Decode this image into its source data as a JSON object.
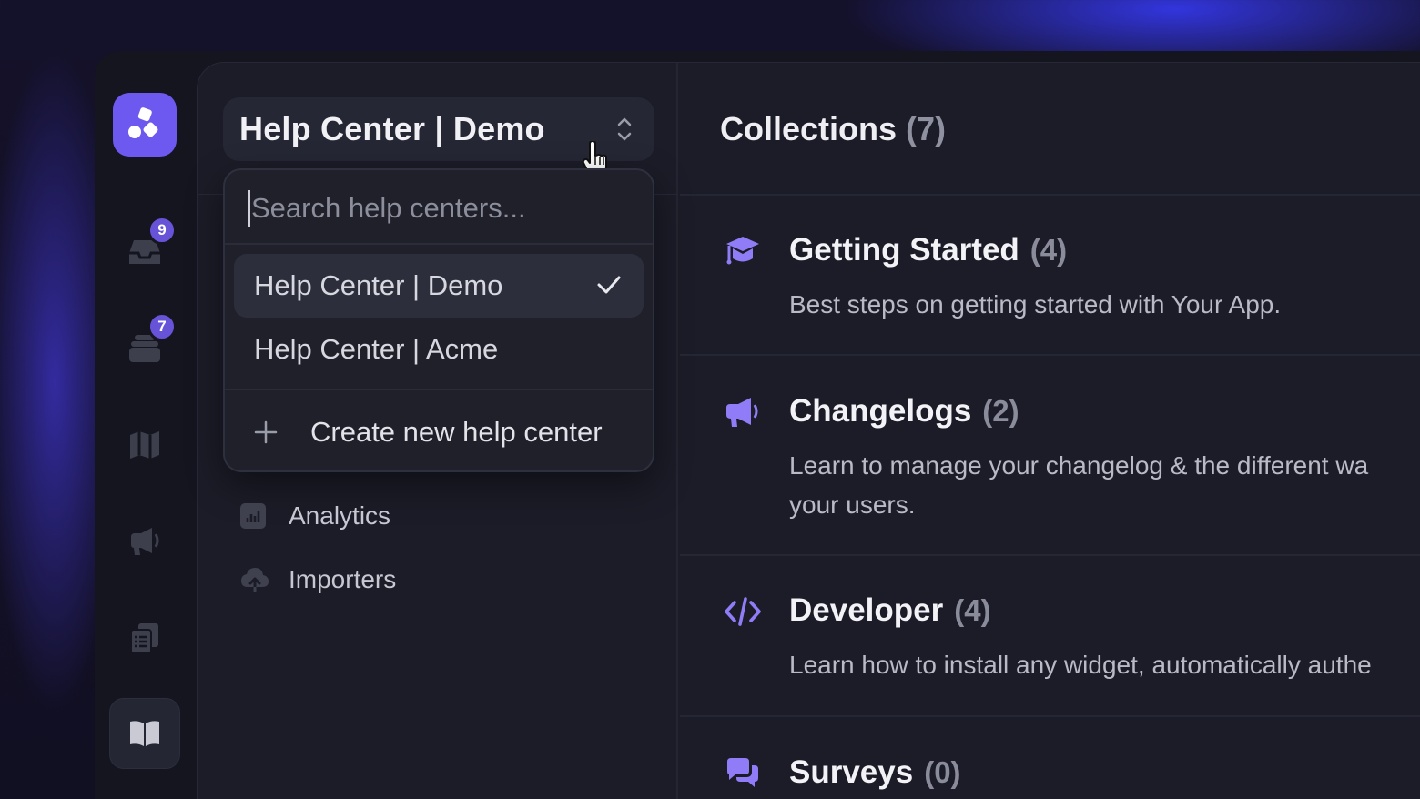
{
  "rail": {
    "badges": {
      "inbox": "9",
      "tickets": "7"
    }
  },
  "help_center_selector": {
    "current": "Help Center | Demo"
  },
  "dropdown": {
    "search_placeholder": "Search help centers...",
    "items": [
      {
        "label": "Help Center | Demo",
        "selected": true
      },
      {
        "label": "Help Center | Acme",
        "selected": false
      }
    ],
    "create_label": "Create new help center"
  },
  "nav": [
    {
      "label": "Analytics",
      "icon": "analytics-icon"
    },
    {
      "label": "Importers",
      "icon": "cloud-upload-icon"
    }
  ],
  "collections": {
    "title": "Collections",
    "count": "(7)",
    "items": [
      {
        "name": "Getting Started",
        "count": "(4)",
        "icon": "graduation-cap-icon",
        "desc": [
          "Best steps on getting started with Your App."
        ]
      },
      {
        "name": "Changelogs",
        "count": "(2)",
        "icon": "megaphone-icon",
        "desc": [
          "Learn to manage your changelog & the different wa",
          "your users."
        ]
      },
      {
        "name": "Developer",
        "count": "(4)",
        "icon": "code-icon",
        "desc": [
          "Learn how to install any widget, automatically authe"
        ]
      },
      {
        "name": "Surveys",
        "count": "(0)",
        "icon": "chat-bubbles-icon",
        "desc": []
      }
    ]
  },
  "colors": {
    "accent": "#6d59f0",
    "badge": "#6653d8",
    "icon_purple": "#8f7cf6"
  }
}
